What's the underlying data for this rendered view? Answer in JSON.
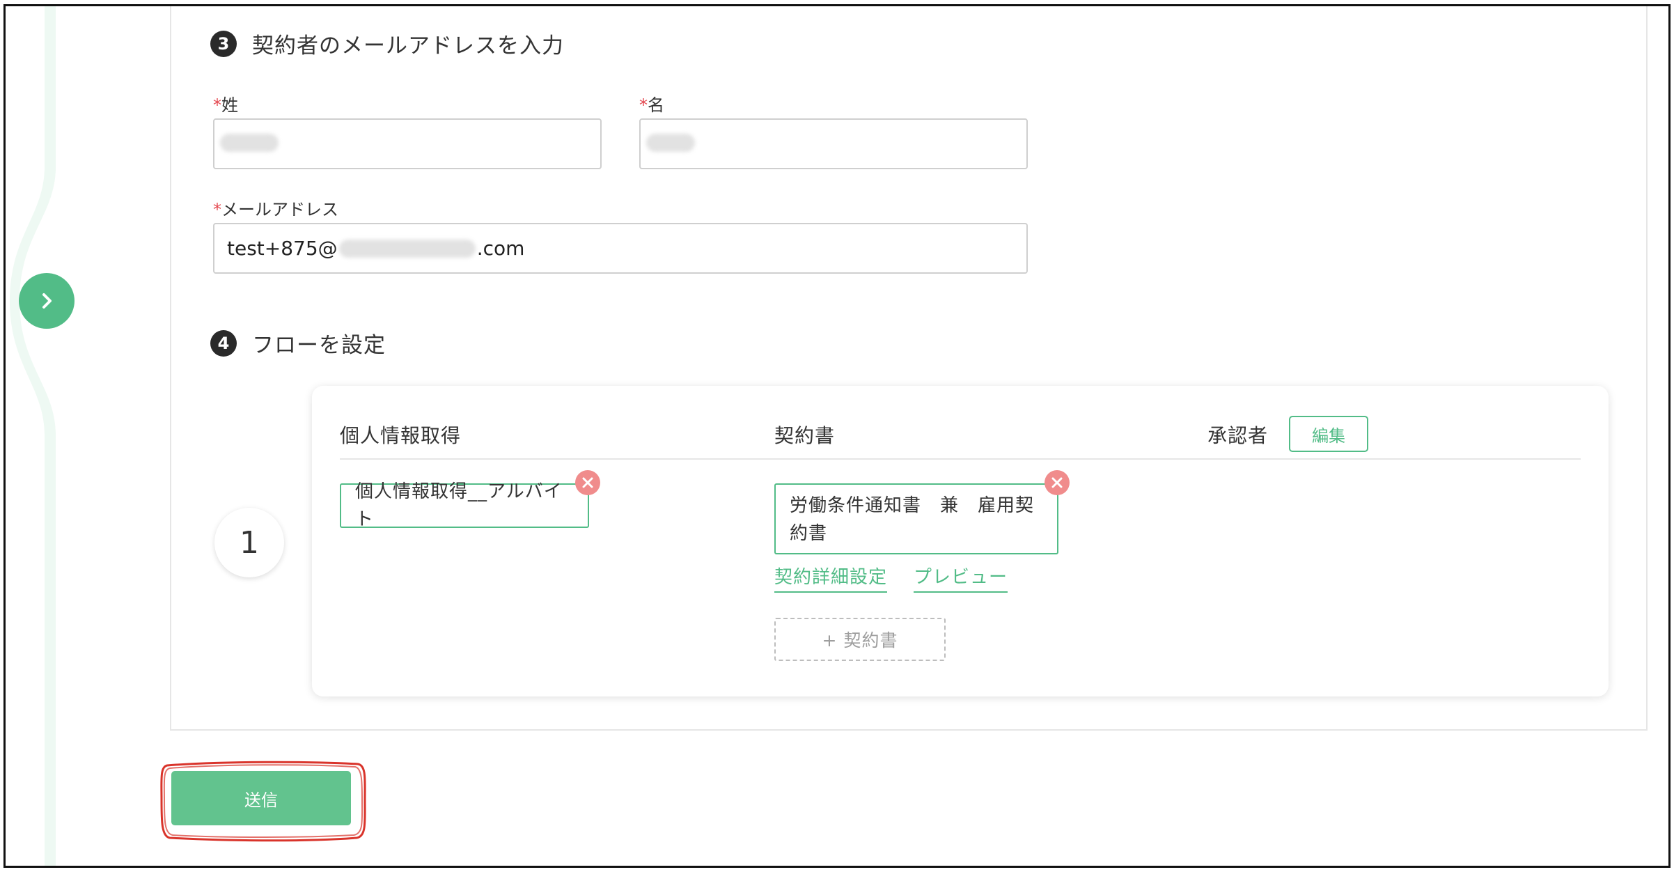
{
  "step3": {
    "number": "3",
    "title": "契約者のメールアドレスを入力",
    "last_name": {
      "label": "姓",
      "required_mark": "*",
      "value": ""
    },
    "first_name": {
      "label": "名",
      "required_mark": "*",
      "value": ""
    },
    "email": {
      "label": "メールアドレス",
      "required_mark": "*",
      "value_prefix": "test+875@",
      "value_suffix": ".com"
    }
  },
  "step4": {
    "number": "4",
    "title": "フローを設定",
    "flow": {
      "columns": {
        "personal_info": "個人情報取得",
        "contract": "契約書",
        "approver": "承認者"
      },
      "edit_label": "編集",
      "rows": [
        {
          "index": "1",
          "personal_info_chip": "個人情報取得__アルバイト",
          "contract_chip_line1": "労働条件通知書　兼　雇用契",
          "contract_chip_line2": "約書",
          "contract_detail_link": "契約詳細設定",
          "preview_link": "プレビュー",
          "add_contract_label": "+ 契約書"
        }
      ]
    }
  },
  "submit_label": "送信",
  "colors": {
    "accent": "#52bc87",
    "required": "#e4474f",
    "remove": "#f08c8c",
    "highlight": "#d9342b"
  },
  "icons": {
    "sidebar_toggle": "chevron-right-icon",
    "remove": "close-circle-icon"
  }
}
